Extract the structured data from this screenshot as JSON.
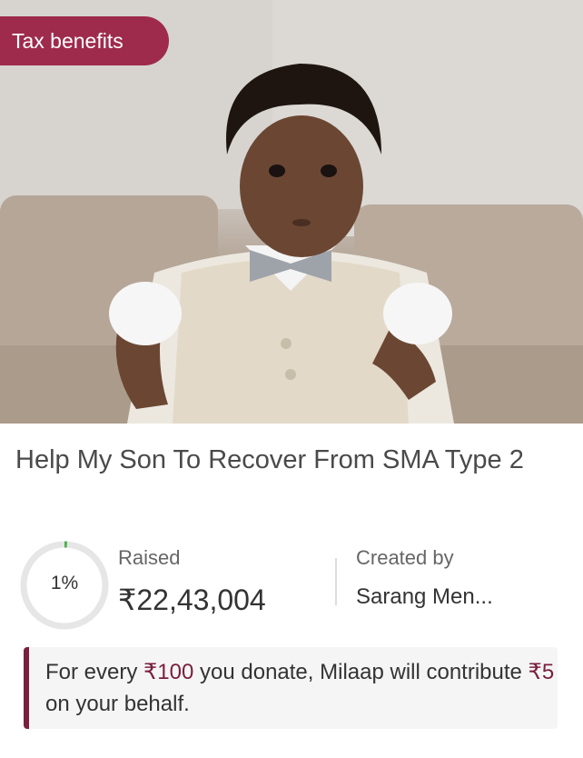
{
  "badge": {
    "label": "Tax benefits"
  },
  "campaign": {
    "title": "Help My Son To Recover From SMA Type 2",
    "progress": {
      "percent_label": "1%",
      "fraction": 0.01
    },
    "raised": {
      "label": "Raised",
      "amount": "₹22,43,004"
    },
    "creator": {
      "label": "Created by",
      "name": "Sarang Men..."
    }
  },
  "notice": {
    "text_1": "For every ",
    "amount_1": "₹100",
    "text_2": " you donate, Milaap will contribute ",
    "amount_2": "₹5",
    "text_3": " on your behalf."
  },
  "colors": {
    "brand": "#9e2a4c",
    "accent": "#7a1f3d",
    "progress": "#4caf50",
    "ring": "#e6e6e6"
  }
}
